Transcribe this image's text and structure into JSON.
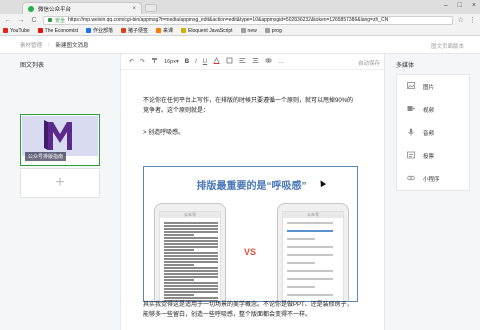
{
  "browser": {
    "tab_title": "微信公众平台",
    "tab_close": "×",
    "window_controls": [
      "–",
      "□",
      "×"
    ],
    "secure_label": "安全",
    "url": "https://mp.weixin.qq.com/cgi-bin/appmsg?t=media/appmsg_edit&action=edit&type=10&appmsgid=502836232&token=1265857386&lang=zh_CN",
    "nav": {
      "back": "←",
      "forward": "→",
      "reload": "C"
    },
    "tool_icons": {
      "star": "☆",
      "menu": "⋮"
    }
  },
  "bookmarks": [
    {
      "label": "YouTube",
      "color": "#e62117"
    },
    {
      "label": "The Economist",
      "color": "#e3120b"
    },
    {
      "label": "作业部落",
      "color": "#1a73e8"
    },
    {
      "label": "猪子便签",
      "color": "#d84315"
    },
    {
      "label": "来课",
      "color": "#f57c00"
    },
    {
      "label": "Eloquent JavaScript",
      "color": "#c9b300"
    },
    {
      "label": "new",
      "color": "#9e9e9e"
    },
    {
      "label": "prog",
      "color": "#9e9e9e"
    }
  ],
  "breadcrumb": {
    "root": "素材管理",
    "separator": "/",
    "current": "新建图文消息",
    "right": "图文页面版本"
  },
  "left": {
    "title": "图文列表",
    "card_caption": "公众号排版指南",
    "add_symbol": "+"
  },
  "editor": {
    "toolbar": {
      "undo": "↶",
      "redo": "↷",
      "font_size": "16px",
      "font_size_caret": "▾",
      "bold": "B",
      "italic": "I",
      "underline": "U",
      "more": "…",
      "save_status": "自动保存"
    },
    "paragraph1": "不论你在任何平台上写作，在排版的时候只要遵循一个原则，就可以甩掉90%的竞争者。这个原则就是：",
    "paragraph2": "> 创造呼吸感。",
    "paragraph3": "其实我觉得这是适用于一切场景的美学概念。不论你是做PPT、还是装修房子，能够多一些留白，创造一些呼吸感，整个版面都会变得不一样。",
    "article_image": {
      "title": "排版最重要的是“呼吸感”",
      "vs": "VS",
      "phone_header": "公众号"
    }
  },
  "media_panel": {
    "title": "多媒体",
    "items": [
      {
        "label": "图片",
        "icon": "image-icon"
      },
      {
        "label": "视频",
        "icon": "video-icon"
      },
      {
        "label": "音频",
        "icon": "audio-icon"
      },
      {
        "label": "投票",
        "icon": "vote-icon"
      },
      {
        "label": "小程序",
        "icon": "miniprogram-icon"
      }
    ]
  },
  "colors": {
    "accent_green": "#2f9e40",
    "article_border": "#5e84b8",
    "vs_red": "#e05040"
  }
}
